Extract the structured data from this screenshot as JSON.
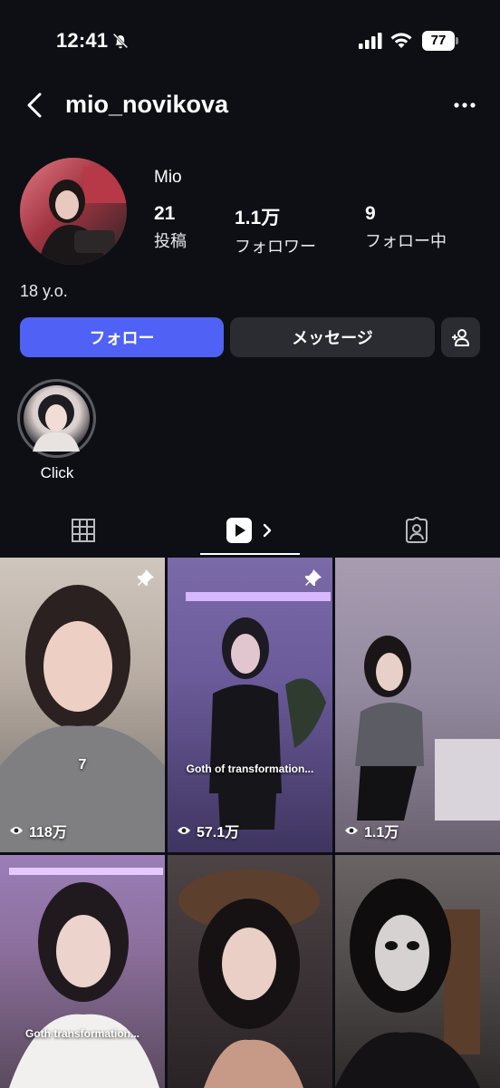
{
  "status_bar": {
    "time": "12:41",
    "battery": "77"
  },
  "header": {
    "username": "mio_novikova"
  },
  "profile": {
    "display_name": "Mio",
    "stats": [
      {
        "value": "21",
        "label": "投稿"
      },
      {
        "value": "1.1万",
        "label": "フォロワー"
      },
      {
        "value": "9",
        "label": "フォロー中"
      }
    ],
    "bio": "18 y.o."
  },
  "actions": {
    "follow_label": "フォロー",
    "message_label": "メッセージ"
  },
  "highlights": [
    {
      "label": "Click"
    }
  ],
  "tabs": [
    "grid",
    "reels",
    "tagged"
  ],
  "reels": [
    {
      "views": "118万",
      "overlay": "7",
      "pinned": true
    },
    {
      "views": "57.1万",
      "overlay": "Goth of transformation...",
      "pinned": true
    },
    {
      "views": "1.1万",
      "overlay": "",
      "pinned": false
    },
    {
      "views": "",
      "overlay": "Goth transformation...",
      "pinned": false
    },
    {
      "views": "",
      "overlay": "",
      "pinned": false
    },
    {
      "views": "",
      "overlay": "",
      "pinned": false
    }
  ],
  "colors": {
    "background": "#0d0f14",
    "follow_button": "#4f62f5",
    "secondary_button": "#2a2c32"
  }
}
